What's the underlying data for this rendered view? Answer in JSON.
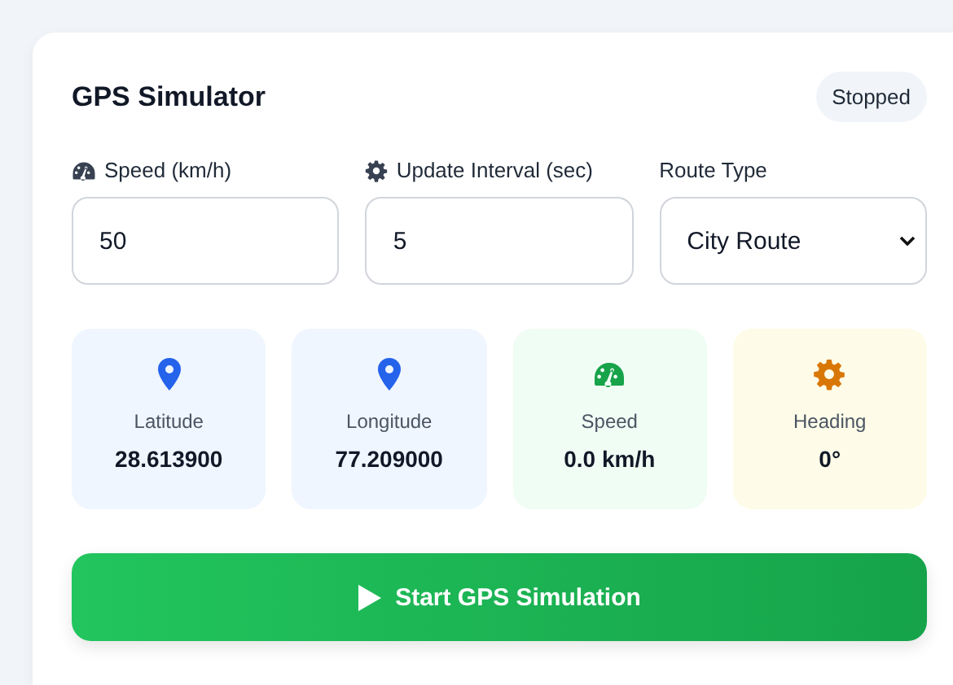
{
  "card": {
    "title": "GPS Simulator",
    "status": "Stopped"
  },
  "fields": [
    {
      "label": "Speed (km/h)",
      "kind": "speed",
      "value": "50"
    },
    {
      "label": "Update Interval (sec)",
      "kind": "interval",
      "value": "5"
    },
    {
      "label": "Route Type",
      "kind": "route",
      "value": "City Route"
    }
  ],
  "stats": [
    {
      "kind": "location",
      "label": "Latitude",
      "value": "28.613900"
    },
    {
      "kind": "location",
      "label": "Longitude",
      "value": "77.209000"
    },
    {
      "kind": "speed",
      "label": "Speed",
      "value": "0.0 km/h"
    },
    {
      "kind": "heading",
      "label": "Heading",
      "value": "0°"
    }
  ],
  "start_button": {
    "label": "Start GPS Simulation"
  }
}
